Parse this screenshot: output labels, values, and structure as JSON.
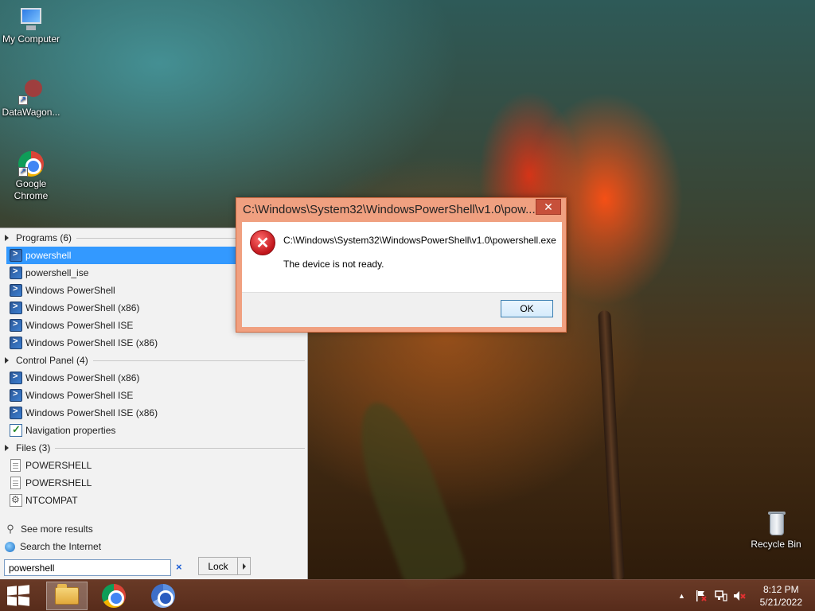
{
  "desktop": {
    "icons": [
      {
        "label": "My Computer",
        "icon": "computer-icon"
      },
      {
        "label": "DataWagon...",
        "icon": "datawagon-icon"
      },
      {
        "label_line1": "Google",
        "label_line2": "Chrome",
        "icon": "chrome-icon"
      },
      {
        "label": "Recycle Bin",
        "icon": "recycle-bin-icon"
      }
    ]
  },
  "start_menu": {
    "groups": [
      {
        "header": "Programs (6)",
        "items": [
          {
            "label": "powershell",
            "selected": true,
            "icon": "powershell-icon"
          },
          {
            "label": "powershell_ise",
            "icon": "powershell-icon"
          },
          {
            "label": "Windows PowerShell",
            "icon": "powershell-icon"
          },
          {
            "label": "Windows PowerShell (x86)",
            "icon": "powershell-icon"
          },
          {
            "label": "Windows PowerShell ISE",
            "icon": "powershell-icon"
          },
          {
            "label": "Windows PowerShell ISE (x86)",
            "icon": "powershell-icon"
          }
        ]
      },
      {
        "header": "Control Panel (4)",
        "items": [
          {
            "label": "Windows PowerShell (x86)",
            "icon": "powershell-icon"
          },
          {
            "label": "Windows PowerShell ISE",
            "icon": "powershell-icon"
          },
          {
            "label": "Windows PowerShell ISE (x86)",
            "icon": "powershell-icon"
          },
          {
            "label": "Navigation properties",
            "icon": "checkbox-settings-icon"
          }
        ]
      },
      {
        "header": "Files (3)",
        "items": [
          {
            "label": "POWERSHELL",
            "icon": "file-icon"
          },
          {
            "label": "POWERSHELL",
            "icon": "file-icon"
          },
          {
            "label": "NTCOMPAT",
            "icon": "system-file-icon"
          }
        ]
      }
    ],
    "see_more": "See more results",
    "search_internet": "Search the Internet",
    "search_value": "powershell",
    "clear_symbol": "×",
    "lock_label": "Lock"
  },
  "dialog": {
    "title": "C:\\Windows\\System32\\WindowsPowerShell\\v1.0\\pow...",
    "close_symbol": "✕",
    "icon_symbol": "✕",
    "path": "C:\\Windows\\System32\\WindowsPowerShell\\v1.0\\powershell.exe",
    "message": "The device is not ready.",
    "ok_label": "OK"
  },
  "taskbar": {
    "apps": [
      {
        "name": "file-explorer",
        "active": true
      },
      {
        "name": "google-chrome",
        "active": false
      },
      {
        "name": "chromium",
        "active": false
      }
    ],
    "tray_icons": [
      "show-hidden-icons-arrow",
      "action-center-flag-icon",
      "network-icon",
      "volume-muted-icon"
    ],
    "tray_arrow": "▲",
    "time": "8:12 PM",
    "date": "5/21/2022"
  },
  "colors": {
    "selection": "#3399ff",
    "dialog_frame": "#f0a080",
    "close_button": "#c7503a",
    "taskbar": "#6e3c28"
  }
}
